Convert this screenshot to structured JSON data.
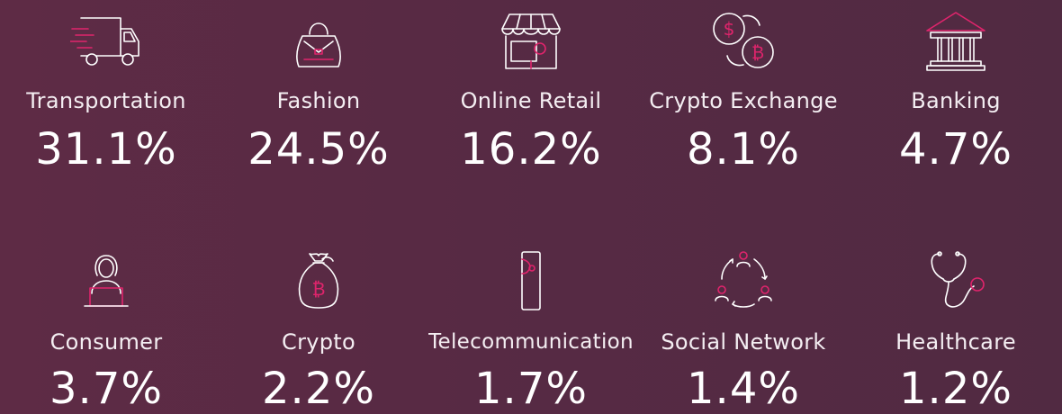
{
  "colors": {
    "background": "#572a44",
    "icon_stroke": "#ffffff",
    "accent": "#e0246c",
    "text": "#ffffff"
  },
  "rows": [
    {
      "items": [
        {
          "label": "Transportation",
          "value": "31.1%",
          "icon": "truck-icon"
        },
        {
          "label": "Fashion",
          "value": "24.5%",
          "icon": "handbag-icon"
        },
        {
          "label": "Online Retail",
          "value": "16.2%",
          "icon": "storefront-icon"
        },
        {
          "label": "Crypto Exchange",
          "value": "8.1%",
          "icon": "currency-exchange-icon"
        },
        {
          "label": "Banking",
          "value": "4.7%",
          "icon": "bank-icon"
        }
      ]
    },
    {
      "items": [
        {
          "label": "Consumer",
          "value": "3.7%",
          "icon": "person-laptop-icon"
        },
        {
          "label": "Crypto",
          "value": "2.2%",
          "icon": "money-bag-icon"
        },
        {
          "label": "Telecommunication",
          "value": "1.7%",
          "icon": "smartphone-icon"
        },
        {
          "label": "Social Network",
          "value": "1.4%",
          "icon": "network-icon"
        },
        {
          "label": "Healthcare",
          "value": "1.2%",
          "icon": "stethoscope-icon"
        }
      ]
    }
  ]
}
